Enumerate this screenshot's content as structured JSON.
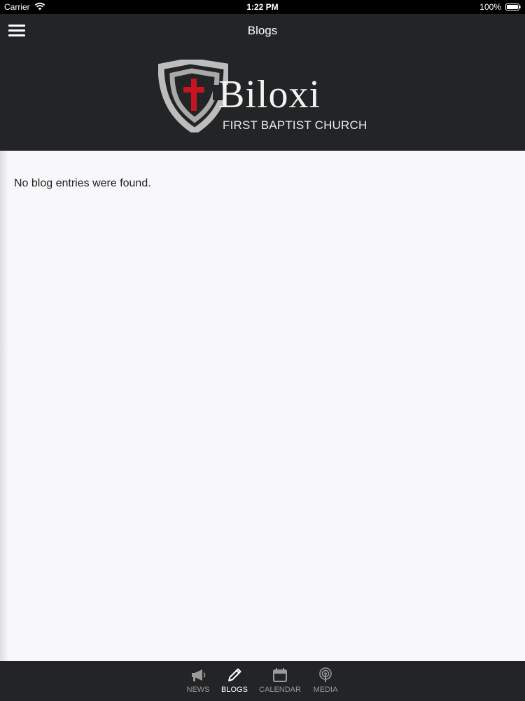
{
  "status_bar": {
    "carrier": "Carrier",
    "time": "1:22 PM",
    "battery": "100%"
  },
  "nav": {
    "title": "Blogs",
    "menu_icon": "hamburger-menu-icon"
  },
  "logo": {
    "name": "Biloxi",
    "subtitle": "FIRST BAPTIST CHURCH"
  },
  "content": {
    "empty_message": "No blog entries were found."
  },
  "tabs": [
    {
      "label": "NEWS",
      "icon": "megaphone-icon",
      "active": false
    },
    {
      "label": "BLOGS",
      "icon": "pencil-icon",
      "active": true
    },
    {
      "label": "CALENDAR",
      "icon": "calendar-icon",
      "active": false
    },
    {
      "label": "MEDIA",
      "icon": "podcast-icon",
      "active": false
    }
  ],
  "colors": {
    "bar_background": "#222425",
    "content_background": "#f8f8fa",
    "cross_red": "#c8141e",
    "tab_active": "#ffffff",
    "tab_inactive": "#9a9a9a"
  }
}
